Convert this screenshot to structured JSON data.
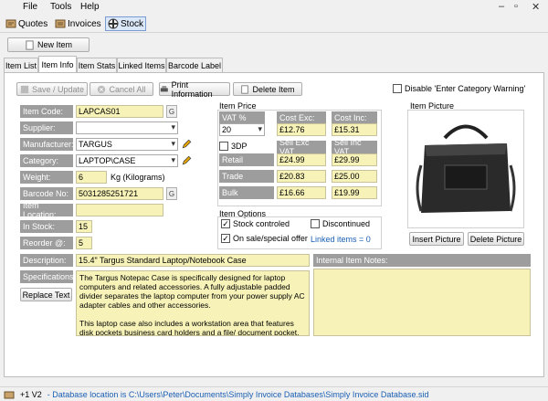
{
  "menu": {
    "file": "File",
    "tools": "Tools",
    "help": "Help"
  },
  "toolbar": {
    "quotes": "Quotes",
    "invoices": "Invoices",
    "stock": "Stock"
  },
  "new_item": "New Item",
  "tabs": [
    "Item List",
    "Item Info",
    "Item Stats",
    "Linked Items",
    "Barcode Label"
  ],
  "actions": {
    "save": "Save / Update",
    "cancel": "Cancel All",
    "print": "Print Information",
    "delete": "Delete Item",
    "disable_warning": "Disable 'Enter Category Warning'"
  },
  "fields": {
    "item_code": {
      "label": "Item Code:",
      "value": "LAPCAS01"
    },
    "supplier": {
      "label": "Supplier:",
      "value": ""
    },
    "manufacturer": {
      "label": "Manufacturer:",
      "value": "TARGUS"
    },
    "category": {
      "label": "Category:",
      "value": "LAPTOP\\CASE"
    },
    "weight": {
      "label": "Weight:",
      "value": "6",
      "unit": "Kg (Kilograms)"
    },
    "barcode": {
      "label": "Barcode No:",
      "value": "5031285251721"
    },
    "location": {
      "label": "Item Location:",
      "value": ""
    },
    "in_stock": {
      "label": "In Stock:",
      "value": "15"
    },
    "reorder": {
      "label": "Reorder @:",
      "value": "5"
    },
    "description": {
      "label": "Description:",
      "value": "15.4\" Targus Standard Laptop/Notebook Case"
    },
    "specifications": {
      "label": "Specifications:"
    },
    "internal_notes": {
      "label": "Internal Item Notes:"
    }
  },
  "replace_text": "Replace Text",
  "g_btn": "G",
  "spec_text": "The Targus Notepac Case is specifically designed for laptop computers and related accessories. A fully adjustable padded divider separates the laptop computer from your power supply  AC adapter  cables and other accessories.\n\nThis laptop case also includes a workstation area that features disk pockets  business card holders and a file/ document pocket. The",
  "price": {
    "title": "Item Price",
    "vat_label": "VAT %",
    "cost_exc_label": "Cost Exc:",
    "cost_inc_label": "Cost Inc:",
    "vat_value": "20",
    "cost_exc": "£12.76",
    "cost_inc": "£15.31",
    "threedp": "3DP",
    "sell_exc_label": "Sell Exc VAT",
    "sell_inc_label": "Sell Inc VAT",
    "retail_label": "Retail",
    "trade_label": "Trade",
    "bulk_label": "Bulk",
    "retail_exc": "£24.99",
    "retail_inc": "£29.99",
    "trade_exc": "£20.83",
    "trade_inc": "£25.00",
    "bulk_exc": "£16.66",
    "bulk_inc": "£19.99"
  },
  "options": {
    "title": "Item Options",
    "stock_controlled": "Stock controled",
    "discontinued": "Discontinued",
    "on_sale": "On sale/special offer",
    "linked": "Linked items = 0"
  },
  "picture": {
    "title": "Item Picture",
    "insert": "Insert Picture",
    "delete": "Delete Picture"
  },
  "status": {
    "version": "+1 V2",
    "db": "- Database location is C:\\Users\\Peter\\Documents\\Simply Invoice Databases\\Simply Invoice Database.sid"
  },
  "colors": {
    "label_bg": "#9d9d9d",
    "field_bg": "#f7f3b8",
    "link": "#1a5fb4"
  }
}
